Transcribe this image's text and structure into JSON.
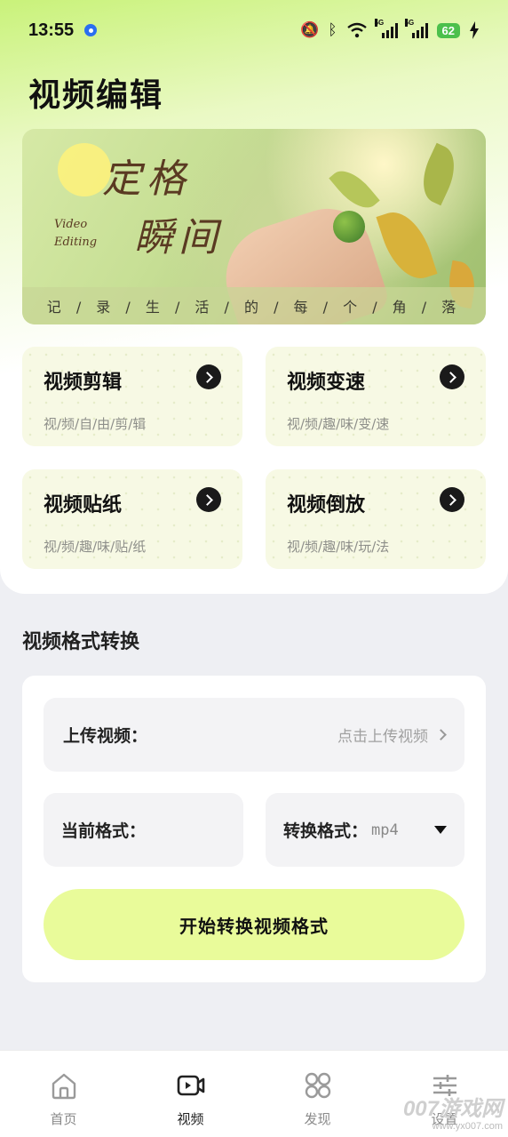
{
  "status_bar": {
    "time": "13:55",
    "signal_tag_1": "5G",
    "signal_tag_2": "5G",
    "battery": "62"
  },
  "header": {
    "title": "视频编辑"
  },
  "banner": {
    "calligraphy_line1": "定格",
    "calligraphy_line2": "瞬间",
    "english_line1": "Video",
    "english_line2": "Editing",
    "caption": "记 / 录 / 生 / 活 / 的 / 每 / 个 / 角 / 落"
  },
  "tools": [
    {
      "title": "视频剪辑",
      "subtitle": "视/频/自/由/剪/辑"
    },
    {
      "title": "视频变速",
      "subtitle": "视/频/趣/味/变/速"
    },
    {
      "title": "视频贴纸",
      "subtitle": "视/频/趣/味/贴/纸"
    },
    {
      "title": "视频倒放",
      "subtitle": "视/频/趣/味/玩/法"
    }
  ],
  "converter": {
    "section_title": "视频格式转换",
    "upload_label": "上传视频：",
    "upload_hint": "点击上传视频",
    "current_format_label": "当前格式：",
    "target_format_label": "转换格式：",
    "target_format_value": "mp4",
    "start_button": "开始转换视频格式"
  },
  "bottom_nav": [
    {
      "label": "首页",
      "icon": "home-icon",
      "active": false
    },
    {
      "label": "视频",
      "icon": "video-icon",
      "active": true
    },
    {
      "label": "发现",
      "icon": "discover-icon",
      "active": false
    },
    {
      "label": "设置",
      "icon": "settings-sliders-icon",
      "active": false
    }
  ],
  "watermark": {
    "line1": "007游戏网",
    "line2": "www.yx007.com"
  }
}
